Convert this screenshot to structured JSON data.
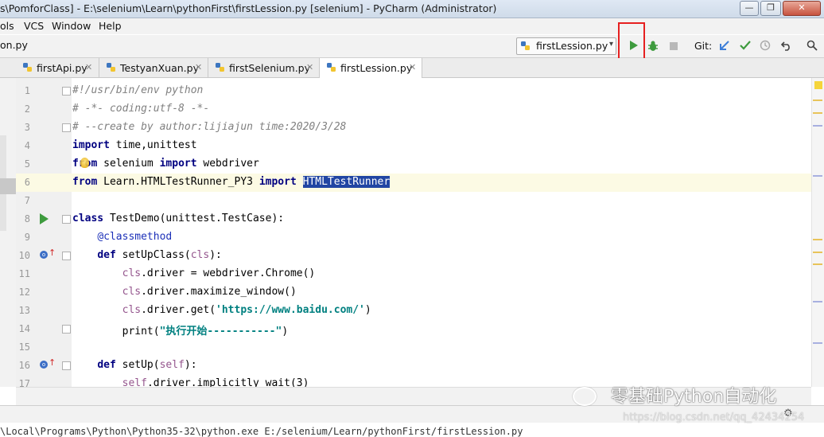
{
  "window": {
    "title": "s\\PomforClass] - E:\\selenium\\Learn\\pythonFirst\\firstLession.py [selenium] - PyCharm (Administrator)",
    "minimize": "—",
    "maximize": "❐",
    "close": "✕"
  },
  "menu": [
    "ols",
    "VCS",
    "Window",
    "Help"
  ],
  "nav": {
    "breadcrumb": "on.py",
    "run_config": "firstLession.py",
    "git_label": "Git:"
  },
  "tabs": [
    {
      "label": "firstApi.py",
      "active": false
    },
    {
      "label": "TestyanXuan.py",
      "active": false
    },
    {
      "label": "firstSelenium.py",
      "active": false
    },
    {
      "label": "firstLession.py",
      "active": true
    }
  ],
  "editor": {
    "lines": [
      {
        "n": "1",
        "segs": [
          {
            "t": "#!/usr/bin/env python",
            "c": "c"
          }
        ]
      },
      {
        "n": "2",
        "segs": [
          {
            "t": "# -*- coding:utf-8 -*-",
            "c": "c"
          }
        ]
      },
      {
        "n": "3",
        "segs": [
          {
            "t": "# --create by author:lijiajun time:2020/3/28",
            "c": "c"
          }
        ]
      },
      {
        "n": "4",
        "segs": [
          {
            "t": "import",
            "c": "k"
          },
          {
            "t": " time,unittest",
            "c": ""
          }
        ]
      },
      {
        "n": "5",
        "segs": [
          {
            "t": "from",
            "c": "k"
          },
          {
            "t": " selenium ",
            "c": ""
          },
          {
            "t": "import",
            "c": "k"
          },
          {
            "t": " webdriver",
            "c": ""
          }
        ]
      },
      {
        "n": "6",
        "segs": [
          {
            "t": "from",
            "c": "k"
          },
          {
            "t": " Learn.HTMLTestRunner_PY3 ",
            "c": ""
          },
          {
            "t": "import",
            "c": "k"
          },
          {
            "t": " ",
            "c": ""
          },
          {
            "t": "HTMLTestRunner",
            "c": "sel"
          }
        ]
      },
      {
        "n": "7",
        "segs": []
      },
      {
        "n": "8",
        "segs": [
          {
            "t": "class",
            "c": "k"
          },
          {
            "t": " TestDemo(unittest.TestCase):",
            "c": ""
          }
        ]
      },
      {
        "n": "9",
        "segs": [
          {
            "t": "    ",
            "c": ""
          },
          {
            "t": "@classmethod",
            "c": "dec"
          }
        ]
      },
      {
        "n": "10",
        "segs": [
          {
            "t": "    ",
            "c": ""
          },
          {
            "t": "def",
            "c": "k"
          },
          {
            "t": " setUpClass(",
            "c": ""
          },
          {
            "t": "cls",
            "c": "slf"
          },
          {
            "t": "):",
            "c": ""
          }
        ]
      },
      {
        "n": "11",
        "segs": [
          {
            "t": "        ",
            "c": ""
          },
          {
            "t": "cls",
            "c": "slf"
          },
          {
            "t": ".driver = webdriver.Chrome()",
            "c": ""
          }
        ]
      },
      {
        "n": "12",
        "segs": [
          {
            "t": "        ",
            "c": ""
          },
          {
            "t": "cls",
            "c": "slf"
          },
          {
            "t": ".driver.maximize_window()",
            "c": ""
          }
        ]
      },
      {
        "n": "13",
        "segs": [
          {
            "t": "        ",
            "c": ""
          },
          {
            "t": "cls",
            "c": "slf"
          },
          {
            "t": ".driver.get(",
            "c": ""
          },
          {
            "t": "'https://www.baidu.com/'",
            "c": "str"
          },
          {
            "t": ")",
            "c": ""
          }
        ]
      },
      {
        "n": "14",
        "segs": [
          {
            "t": "        print(",
            "c": ""
          },
          {
            "t": "\"执行开始-----------\"",
            "c": "str"
          },
          {
            "t": ")",
            "c": ""
          }
        ]
      },
      {
        "n": "15",
        "segs": []
      },
      {
        "n": "16",
        "segs": [
          {
            "t": "    ",
            "c": ""
          },
          {
            "t": "def",
            "c": "k"
          },
          {
            "t": " setUp(",
            "c": ""
          },
          {
            "t": "self",
            "c": "slf"
          },
          {
            "t": "):",
            "c": ""
          }
        ]
      },
      {
        "n": "17",
        "segs": [
          {
            "t": "        ",
            "c": ""
          },
          {
            "t": "self",
            "c": "slf"
          },
          {
            "t": ".driver.implicitly_wait(3)",
            "c": ""
          }
        ]
      }
    ]
  },
  "console": "\\Local\\Programs\\Python\\Python35-32\\python.exe E:/selenium/Learn/pythonFirst/firstLession.py",
  "watermark": {
    "text": "零基础Python自动化",
    "url": "https://blog.csdn.net/qq_42434254"
  },
  "colors": {
    "run_green": "#3e9b3e",
    "highlight_red": "#e62020",
    "selection": "#2145a3"
  }
}
